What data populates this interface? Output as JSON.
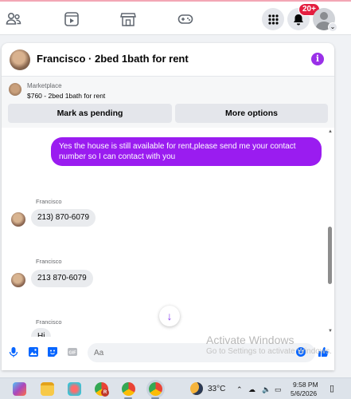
{
  "topbar": {
    "nav_icons": [
      "friends-icon",
      "watch-icon",
      "marketplace-icon",
      "gaming-icon"
    ],
    "notification_badge": "20+"
  },
  "chat": {
    "header_title": "Francisco · 2bed 1bath for rent",
    "listing": {
      "label": "Marketplace",
      "price_title": "$760 - 2bed 1bath for rent",
      "pending_button": "Mark as pending",
      "more_button": "More options"
    },
    "messages": [
      {
        "direction": "outgoing",
        "text": "Yes the house is still available for rent,please send me your contact number so I can contact with you"
      },
      {
        "direction": "incoming",
        "sender": "Francisco",
        "text": "213) 870-6079"
      },
      {
        "direction": "incoming",
        "sender": "Francisco",
        "text": "213 870-6079"
      },
      {
        "direction": "incoming",
        "sender": "Francisco",
        "text": "Hi"
      }
    ],
    "composer_placeholder": "Aa"
  },
  "watermark": {
    "title": "Activate Windows",
    "subtitle": "Go to Settings to activate Windows."
  },
  "taskbar": {
    "weather_temp": "33°C",
    "time": "9:58 PM",
    "date": "5/6/2026"
  },
  "colors": {
    "accent": "#9a1cf0",
    "badge": "#e41e3f",
    "bubble_incoming": "#e9ebee"
  }
}
